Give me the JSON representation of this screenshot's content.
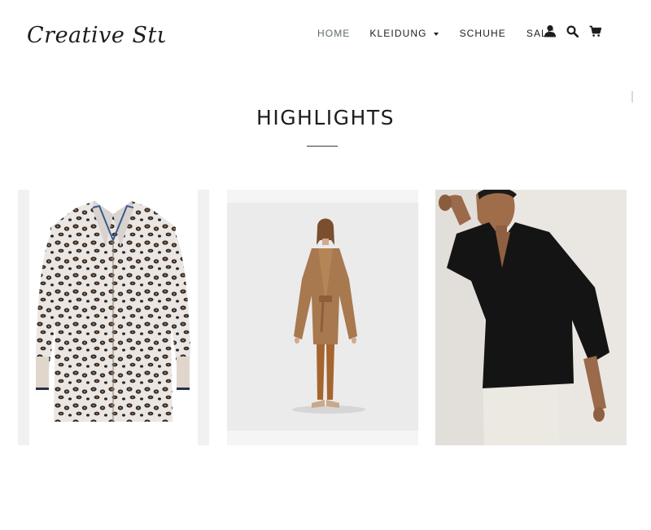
{
  "header": {
    "logo_text": "Creative Studio",
    "nav": [
      {
        "label": "HOME",
        "active": true
      },
      {
        "label": "KLEIDUNG",
        "has_dropdown": true
      },
      {
        "label": "SCHUHE"
      },
      {
        "label": "SALE"
      }
    ],
    "icons": [
      "account-icon",
      "search-icon",
      "cart-icon"
    ]
  },
  "highlights": {
    "title": "HIGHLIGHTS",
    "products": [
      {
        "image": "leopard-print-blouse"
      },
      {
        "image": "brown-suede-outfit"
      },
      {
        "image": "black-v-neck-top"
      }
    ]
  },
  "colors": {
    "text": "#1c1d1d",
    "nav_active": "#5f6a6a",
    "background": "#ffffff"
  }
}
